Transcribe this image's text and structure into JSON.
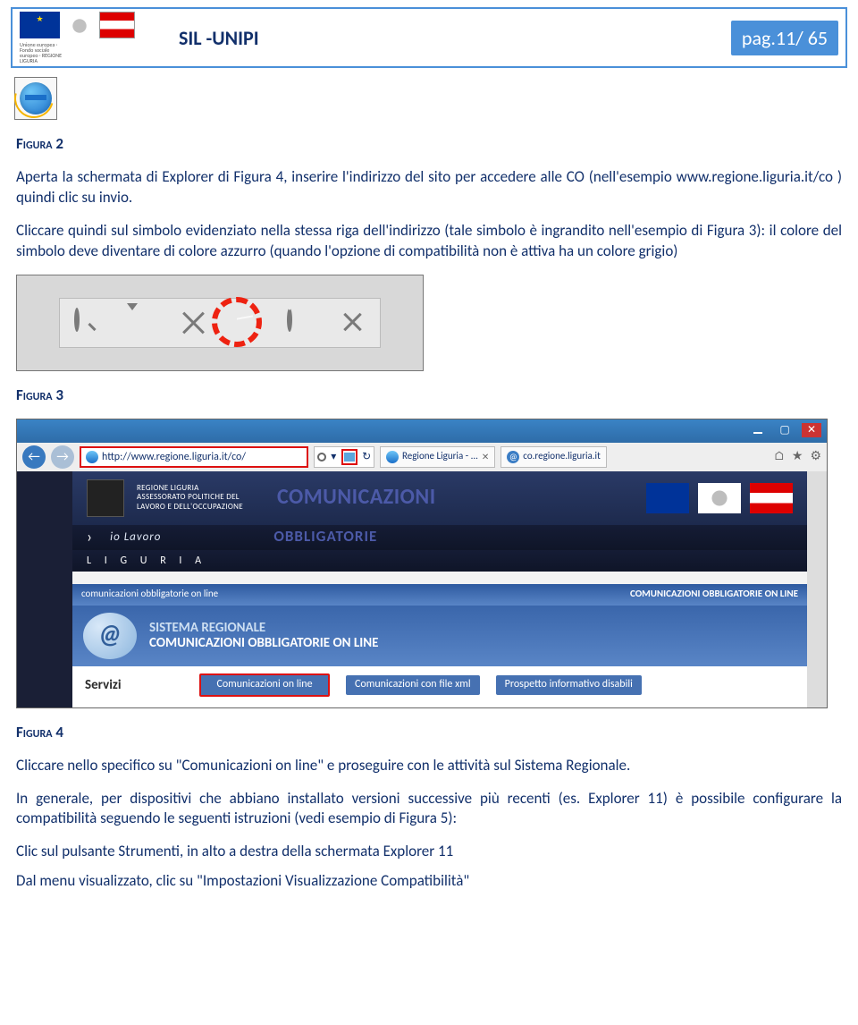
{
  "header": {
    "title": "SIL -UNIPI",
    "page_badge": "pag.11/ 65",
    "logos_caption": "Unione europea · Fondo sociale europeo · REGIONE LIGURIA"
  },
  "captions": {
    "fig2": "Figura 2",
    "fig3": "Figura 3",
    "fig4": "Figura 4"
  },
  "para1": "Aperta la schermata di Explorer di Figura 4, inserire l'indirizzo del sito per accedere alle CO  (nell'esempio www.regione.liguria.it/co ) quindi clic su invio.",
  "para2": "Cliccare quindi sul simbolo evidenziato nella stessa riga dell'indirizzo (tale simbolo è ingrandito nell'esempio di Figura 3): il colore del simbolo deve diventare di colore azzurro (quando l'opzione di compatibilità non è attiva ha un colore grigio)",
  "para3": "Cliccare nello specifico su \"Comunicazioni on line\" e proseguire con le attività sul Sistema Regionale.",
  "para4": "In generale, per dispositivi che abbiano installato versioni successive più recenti (es. Explorer 11) è possibile configurare la compatibilità seguendo le seguenti istruzioni (vedi esempio di Figura 5):",
  "para5": "Clic sul pulsante Strumenti, in alto a destra della schermata Explorer 11",
  "para6": "Dal menu visualizzato, clic su \"Impostazioni Visualizzazione Compatibilità\"",
  "fig4": {
    "url": "http://www.regione.liguria.it/co/",
    "tab1": "Regione Liguria - ...",
    "tab2": "co.regione.liguria.it",
    "band_small": "REGIONE LIGURIA\nASSESSORATO POLITICHE DEL\nLAVORO E DELL'OCCUPAZIONE",
    "title_big": "COMUNICAZIONI",
    "io": "io Lavoro",
    "liguria": "L I G U R I A",
    "obbl": "OBBLIGATORIE",
    "bar_left": "comunicazioni obbligatorie on line",
    "bar_right": "COMUNICAZIONI OBBLIGATORIE ON LINE",
    "sys_l1": "SISTEMA REGIONALE",
    "sys_l2": "COMUNICAZIONI OBBLIGATORIE ON LINE",
    "servizi": "Servizi",
    "btn1": "Comunicazioni on line",
    "btn2": "Comunicazioni con file xml",
    "btn3": "Prospetto informativo disabili",
    "at": "@",
    "search_label": "ρ"
  }
}
